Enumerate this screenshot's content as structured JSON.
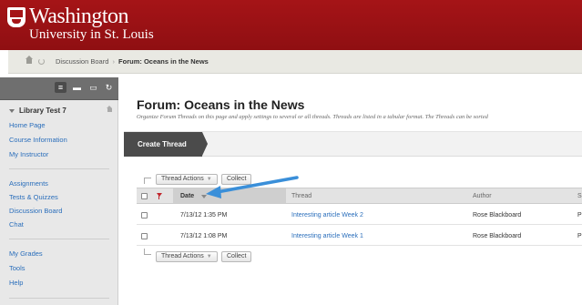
{
  "header": {
    "logo_line1": "Washington",
    "logo_line2": "University in St. Louis"
  },
  "breadcrumb": {
    "items": [
      "Discussion Board"
    ],
    "current": "Forum: Oceans in the News",
    "separator": "›"
  },
  "sidebar": {
    "course_title": "Library Test 7",
    "group1": [
      "Home Page",
      "Course Information",
      "My Instructor"
    ],
    "group2": [
      "Assignments",
      "Tests & Quizzes",
      "Discussion Board",
      "Chat"
    ],
    "group3": [
      "My Grades",
      "Tools",
      "Help"
    ]
  },
  "main": {
    "title": "Forum: Oceans in the News",
    "description": "Organize Forum Threads on this page and apply settings to several or all threads. Threads are listed in a tabular format. The Threads can be sorted",
    "create_thread_label": "Create Thread",
    "thread_actions_label": "Thread Actions",
    "collect_label": "Collect"
  },
  "table": {
    "columns": {
      "date": "Date",
      "thread": "Thread",
      "author": "Author",
      "status": "S"
    },
    "rows": [
      {
        "date": "7/13/12 1:35 PM",
        "thread": "Interesting article Week 2",
        "author": "Rose Blackboard",
        "status": "P"
      },
      {
        "date": "7/13/12 1:08 PM",
        "thread": "Interesting article Week 1",
        "author": "Rose Blackboard",
        "status": "P"
      }
    ]
  },
  "colors": {
    "brand_red": "#a51417",
    "link_blue": "#2a6ebb",
    "annotation_blue": "#3a8fd9"
  }
}
